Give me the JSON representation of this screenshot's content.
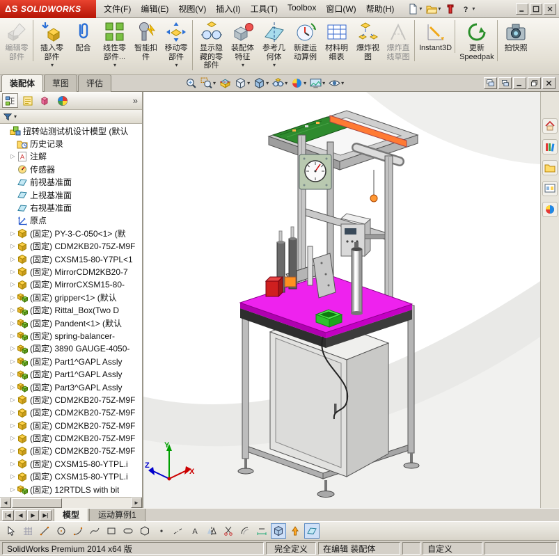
{
  "title_bar": {
    "logo_mark": "ΔS",
    "logo_text": "SOLIDWORKS"
  },
  "menu_bar": {
    "items": [
      "文件(F)",
      "编辑(E)",
      "视图(V)",
      "插入(I)",
      "工具(T)",
      "Toolbox",
      "窗口(W)",
      "帮助(H)"
    ]
  },
  "quick_access": [
    {
      "icon": "new-doc-icon",
      "arrow": true
    },
    {
      "icon": "open-icon",
      "arrow": true
    },
    {
      "icon": "rebuild-icon",
      "arrow": false
    },
    {
      "icon": "help-icon",
      "arrow": true
    }
  ],
  "window_controls": [
    {
      "icon": "minimize-icon"
    },
    {
      "icon": "maximize-icon"
    },
    {
      "icon": "close-icon"
    }
  ],
  "ribbon": {
    "buttons": [
      {
        "line1": "编辑零",
        "line2": "部件",
        "icon": "edit-component-icon",
        "disabled": true,
        "group_end": true
      },
      {
        "line1": "插入零",
        "line2": "部件",
        "icon": "insert-component-icon",
        "arrow": true
      },
      {
        "line1": "配合",
        "line2": "",
        "icon": "mate-icon"
      },
      {
        "line1": "线性零",
        "line2": "部件...",
        "icon": "linear-pattern-icon",
        "arrow": true
      },
      {
        "line1": "智能扣",
        "line2": "件",
        "icon": "smart-fastener-icon"
      },
      {
        "line1": "移动零",
        "line2": "部件",
        "icon": "move-component-icon",
        "arrow": true,
        "group_end": true
      },
      {
        "line1": "显示隐",
        "line2": "藏的零",
        "line3": "部件",
        "icon": "show-hidden-icon"
      },
      {
        "line1": "装配体",
        "line2": "特征",
        "icon": "assembly-feature-icon",
        "arrow": true
      },
      {
        "line1": "参考几",
        "line2": "何体",
        "icon": "reference-geometry-icon",
        "arrow": true
      },
      {
        "line1": "新建运",
        "line2": "动算例",
        "icon": "motion-study-icon"
      },
      {
        "line1": "材料明",
        "line2": "细表",
        "icon": "bom-icon"
      },
      {
        "line1": "爆炸视",
        "line2": "图",
        "icon": "exploded-view-icon"
      },
      {
        "line1": "爆炸直",
        "line2": "线草图",
        "icon": "explode-sketch-icon",
        "disabled": true,
        "group_end": true
      },
      {
        "line1": "Instant3D",
        "line2": "",
        "icon": "instant3d-icon",
        "group_end": true
      },
      {
        "line1": "更新",
        "line2": "Speedpak",
        "icon": "update-speedpak-icon",
        "group_end": true
      },
      {
        "line1": "拍快照",
        "line2": "",
        "icon": "snapshot-icon"
      }
    ]
  },
  "command_tabs": [
    {
      "label": "装配体",
      "active": true
    },
    {
      "label": "草图"
    },
    {
      "label": "评估"
    }
  ],
  "view_toolbar": [
    {
      "icon": "zoom-fit-icon"
    },
    {
      "icon": "zoom-area-icon",
      "arrow": true
    },
    {
      "icon": "section-view-icon"
    },
    {
      "icon": "view-orientation-icon",
      "arrow": true
    },
    {
      "icon": "display-style-icon",
      "arrow": true
    },
    {
      "icon": "hide-items-icon",
      "arrow": true
    },
    {
      "icon": "appearance-icon",
      "arrow": true
    },
    {
      "icon": "scene-icon",
      "arrow": true
    },
    {
      "icon": "view-settings-icon",
      "arrow": true
    }
  ],
  "doc_controls": [
    {
      "icon": "tile-icon"
    },
    {
      "icon": "cascade-icon"
    },
    {
      "icon": "minimize-icon"
    },
    {
      "icon": "restore-icon"
    },
    {
      "icon": "close-icon"
    }
  ],
  "feature_panel": {
    "chevron": "»",
    "header_icons": [
      {
        "icon": "featuremanager-icon",
        "active": true
      },
      {
        "icon": "propertymanager-icon"
      },
      {
        "icon": "configurationmanager-icon"
      },
      {
        "icon": "displaymanager-icon"
      }
    ],
    "filter": {
      "icon": "filter-icon",
      "arrow": "▾"
    },
    "scroll_left": "◄",
    "scroll_right": "►",
    "tree": [
      {
        "icon": "assembly-root-icon",
        "label": "扭转站测试机设计模型 (默认",
        "exp": ""
      },
      {
        "icon": "history-folder-icon",
        "label": "历史记录",
        "exp": "",
        "indent": true
      },
      {
        "icon": "annotations-icon",
        "label": "注解",
        "exp": "▷",
        "indent": true
      },
      {
        "icon": "sensors-icon",
        "label": "传感器",
        "exp": "",
        "indent": true
      },
      {
        "icon": "plane-icon",
        "label": "前视基准面",
        "exp": "",
        "indent": true
      },
      {
        "icon": "plane-icon",
        "label": "上视基准面",
        "exp": "",
        "indent": true
      },
      {
        "icon": "plane-icon",
        "label": "右视基准面",
        "exp": "",
        "indent": true
      },
      {
        "icon": "origin-icon",
        "label": "原点",
        "exp": "",
        "indent": true
      },
      {
        "icon": "part-comp-icon",
        "label": "(固定) PY-3-C-050<1> (默",
        "exp": "▷",
        "indent": true
      },
      {
        "icon": "part-comp-icon",
        "label": "(固定) CDM2KB20-75Z-M9F",
        "exp": "▷",
        "indent": true
      },
      {
        "icon": "part-comp-icon",
        "label": "(固定) CXSM15-80-Y7PL<1",
        "exp": "▷",
        "indent": true
      },
      {
        "icon": "part-comp-icon",
        "label": "(固定) MirrorCDM2KB20-7",
        "exp": "▷",
        "indent": true
      },
      {
        "icon": "part-comp-icon",
        "label": "(固定) MirrorCXSM15-80-",
        "exp": "▷",
        "indent": true
      },
      {
        "icon": "assembly-comp-icon",
        "label": "(固定) gripper<1> (默认",
        "exp": "▷",
        "indent": true
      },
      {
        "icon": "assembly-comp-icon",
        "label": "(固定) Rittal_Box(Two D",
        "exp": "▷",
        "indent": true
      },
      {
        "icon": "assembly-comp-icon",
        "label": "(固定) Pandent<1> (默认",
        "exp": "▷",
        "indent": true
      },
      {
        "icon": "assembly-comp-icon",
        "label": "(固定) spring-balancer-",
        "exp": "▷",
        "indent": true
      },
      {
        "icon": "assembly-comp-icon",
        "label": "(固定) 3890 GAUGE-4050-",
        "exp": "▷",
        "indent": true
      },
      {
        "icon": "assembly-comp-icon",
        "label": "(固定) Part1^GAPL Assly",
        "exp": "▷",
        "indent": true
      },
      {
        "icon": "assembly-comp-icon",
        "label": "(固定) Part1^GAPL Assly",
        "exp": "▷",
        "indent": true
      },
      {
        "icon": "assembly-comp-icon",
        "label": "(固定) Part3^GAPL Assly",
        "exp": "▷",
        "indent": true
      },
      {
        "icon": "part-comp-icon",
        "label": "(固定) CDM2KB20-75Z-M9F",
        "exp": "▷",
        "indent": true
      },
      {
        "icon": "part-comp-icon",
        "label": "(固定) CDM2KB20-75Z-M9F",
        "exp": "▷",
        "indent": true
      },
      {
        "icon": "part-comp-icon",
        "label": "(固定) CDM2KB20-75Z-M9F",
        "exp": "▷",
        "indent": true
      },
      {
        "icon": "part-comp-icon",
        "label": "(固定) CDM2KB20-75Z-M9F",
        "exp": "▷",
        "indent": true
      },
      {
        "icon": "part-comp-icon",
        "label": "(固定) CDM2KB20-75Z-M9F",
        "exp": "▷",
        "indent": true
      },
      {
        "icon": "part-comp-icon",
        "label": "(固定) CXSM15-80-YTPL.i",
        "exp": "▷",
        "indent": true
      },
      {
        "icon": "part-comp-icon",
        "label": "(固定) CXSM15-80-YTPL.i",
        "exp": "▷",
        "indent": true
      },
      {
        "icon": "assembly-comp-icon",
        "label": "(固定) 12RTDLS with bit",
        "exp": "▷",
        "indent": true
      }
    ]
  },
  "task_pane": [
    {
      "icon": "home-icon"
    },
    {
      "icon": "design-library-icon"
    },
    {
      "icon": "file-explorer-icon"
    },
    {
      "icon": "view-palette-icon"
    },
    {
      "icon": "appearances-icon"
    }
  ],
  "viewport": {
    "triad": {
      "x": "X",
      "y": "Y",
      "z": "Z"
    }
  },
  "bottom": {
    "nav": [
      "|◀",
      "◀",
      "▶",
      "▶|"
    ],
    "tabs": [
      {
        "label": "模型",
        "active": true
      },
      {
        "label": "运动算例1"
      }
    ]
  },
  "sketch_toolbar": [
    {
      "icon": "sk-select-icon"
    },
    {
      "icon": "sk-grid-icon"
    },
    {
      "icon": "sk-line-icon"
    },
    {
      "icon": "sk-circle-icon"
    },
    {
      "icon": "sk-arc-icon"
    },
    {
      "icon": "sk-spline-icon"
    },
    {
      "icon": "sk-rect-icon"
    },
    {
      "icon": "sk-slot-icon"
    },
    {
      "icon": "sk-polygon-icon"
    },
    {
      "icon": "sk-point-icon"
    },
    {
      "icon": "sk-centerline-icon"
    },
    {
      "icon": "sk-text-icon"
    },
    {
      "icon": "sk-mirror-icon"
    },
    {
      "icon": "sk-trim-icon"
    },
    {
      "icon": "sk-offset-icon"
    },
    {
      "icon": "sk-dimension-icon"
    },
    {
      "icon": "sk-cube-icon",
      "active": true
    },
    {
      "icon": "sk-arrow-up-icon"
    },
    {
      "icon": "sk-plane-icon",
      "active": true
    }
  ],
  "status_bar": {
    "left": "SolidWorks Premium 2014 x64 版",
    "defined": "完全定义",
    "editing": "在编辑 装配体",
    "custom": "自定义"
  },
  "colors": {
    "window": "#d4d0c8",
    "logo_red": "#cf1d0e",
    "table_magenta": "#ee22ee",
    "accent_blue": "#316ac5"
  }
}
